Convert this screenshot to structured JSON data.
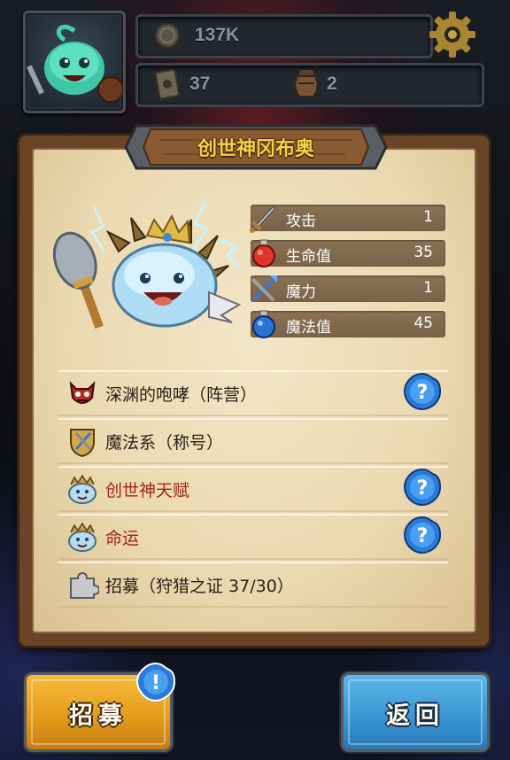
{
  "hud": {
    "coins": "137K",
    "cards": "37",
    "jars": "2",
    "icons": {
      "coin": "coin-icon",
      "card": "card-icon",
      "jar": "jar-icon",
      "settings": "gear-icon"
    }
  },
  "panel": {
    "title": "创世神冈布奥",
    "stats": [
      {
        "label": "攻击",
        "value": "1",
        "icon": "sword-icon"
      },
      {
        "label": "生命值",
        "value": "35",
        "icon": "red-potion-icon"
      },
      {
        "label": "魔力",
        "value": "1",
        "icon": "staff-icon"
      },
      {
        "label": "魔法值",
        "value": "45",
        "icon": "blue-potion-icon"
      }
    ],
    "rows": [
      {
        "text": "深渊的咆哮（阵营）",
        "icon": "demon-mask-icon",
        "has_help": true
      },
      {
        "text": "魔法系（称号）",
        "icon": "magic-shield-icon",
        "has_help": false
      },
      {
        "text": "创世神天赋",
        "icon": "gumball-talent-icon",
        "has_help": true
      },
      {
        "text": "命运",
        "icon": "gumball-fate-icon",
        "has_help": true
      },
      {
        "text": "招募（狩猎之证 37/30）",
        "icon": "puzzle-piece-icon",
        "has_help": false
      }
    ]
  },
  "buttons": {
    "recruit": "招募",
    "back": "返回"
  },
  "colors": {
    "parchment": "#ead8b0",
    "title_gold": "#f2d04a",
    "talent_red": "#a02418",
    "recruit_orange": "#e29a1a",
    "back_blue": "#3a94d2"
  }
}
